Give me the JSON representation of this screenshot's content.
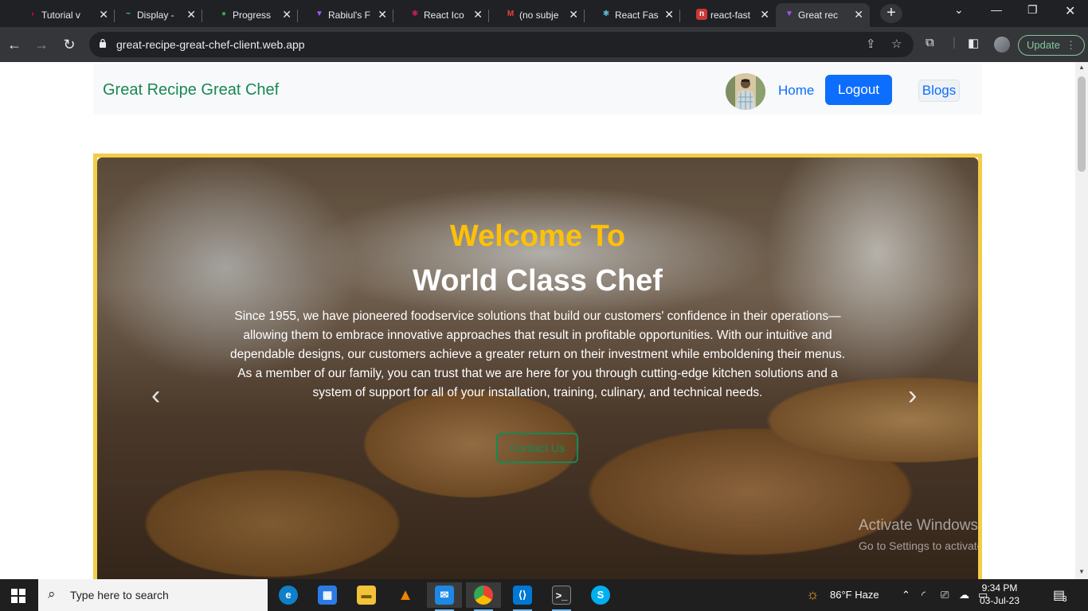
{
  "browser": {
    "tabs": [
      {
        "title": "Tutorial v",
        "fav_color": "#ff0033",
        "fav_glyph": "›"
      },
      {
        "title": "Display -",
        "fav_color": "#38bdf8",
        "fav_glyph": "~"
      },
      {
        "title": "Progress",
        "fav_color": "#34a853",
        "fav_glyph": "●"
      },
      {
        "title": "Rabiul's F",
        "fav_color": "#a855f7",
        "fav_glyph": "▼"
      },
      {
        "title": "React Ico",
        "fav_color": "#e91e63",
        "fav_glyph": "⚛"
      },
      {
        "title": "(no subje",
        "fav_color": "#ea4335",
        "fav_glyph": "M"
      },
      {
        "title": "React Fas",
        "fav_color": "#61dafb",
        "fav_glyph": "⚛"
      },
      {
        "title": "react-fast",
        "fav_color": "#cb3837",
        "fav_glyph": "n"
      },
      {
        "title": "Great rec",
        "fav_color": "#a855f7",
        "fav_glyph": "▼"
      }
    ],
    "new_tab_glyph": "+",
    "url": "great-recipe-great-chef-client.web.app",
    "update_label": "Update"
  },
  "navbar": {
    "brand": "Great Recipe Great Chef",
    "home": "Home",
    "logout": "Logout",
    "blogs": "Blogs"
  },
  "hero": {
    "title_line1": "Welcome To",
    "title_line2": "World Class Chef",
    "text": "Since 1955, we have pioneered foodservice solutions that build our customers' confidence in their operations—allowing them to embrace innovative approaches that result in profitable opportunities. With our intuitive and dependable designs, our customers achieve a greater return on their investment while emboldening their menus. As a member of our family, you can trust that we are here for you through cutting-edge kitchen solutions and a system of support for all of your installation, training, culinary, and technical needs.",
    "button": "Contact Us",
    "prev_glyph": "‹",
    "next_glyph": "›"
  },
  "watermark": {
    "line1": "Activate Windows",
    "line2": "Go to Settings to activate Windows."
  },
  "taskbar": {
    "search_placeholder": "Type here to search",
    "weather": "86°F  Haze",
    "time": "9:34 PM",
    "date": "03-Jul-23",
    "notification_count": "3"
  },
  "colors": {
    "brand_green": "#198754",
    "primary_blue": "#0d6efd",
    "accent_yellow": "#ffc107",
    "frame_yellow": "#f2cd47"
  }
}
